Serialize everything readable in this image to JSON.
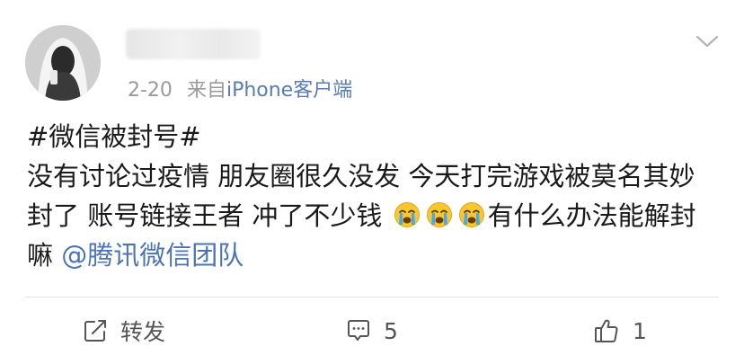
{
  "post": {
    "date": "2-20",
    "source_prefix": "来自",
    "source_client": "iPhone",
    "source_suffix": "客户端",
    "hashtag": "#微信被封号#",
    "text_part1": "没有讨论过疫情 朋友圈很久没发  今天打完游戏被莫名其妙封了 账号链接王者 冲了不少钱 ",
    "text_part2": "有什么办法能解封嘛 ",
    "mention": "@腾讯微信团队",
    "emoji_icon": "crying-face-icon",
    "emoji_count": 3
  },
  "actions": {
    "repost_label": "转发",
    "comment_count": "5",
    "like_count": "1"
  },
  "colors": {
    "link": "#4b74b8",
    "meta": "#9a9a9a",
    "text": "#1a1a1a"
  }
}
